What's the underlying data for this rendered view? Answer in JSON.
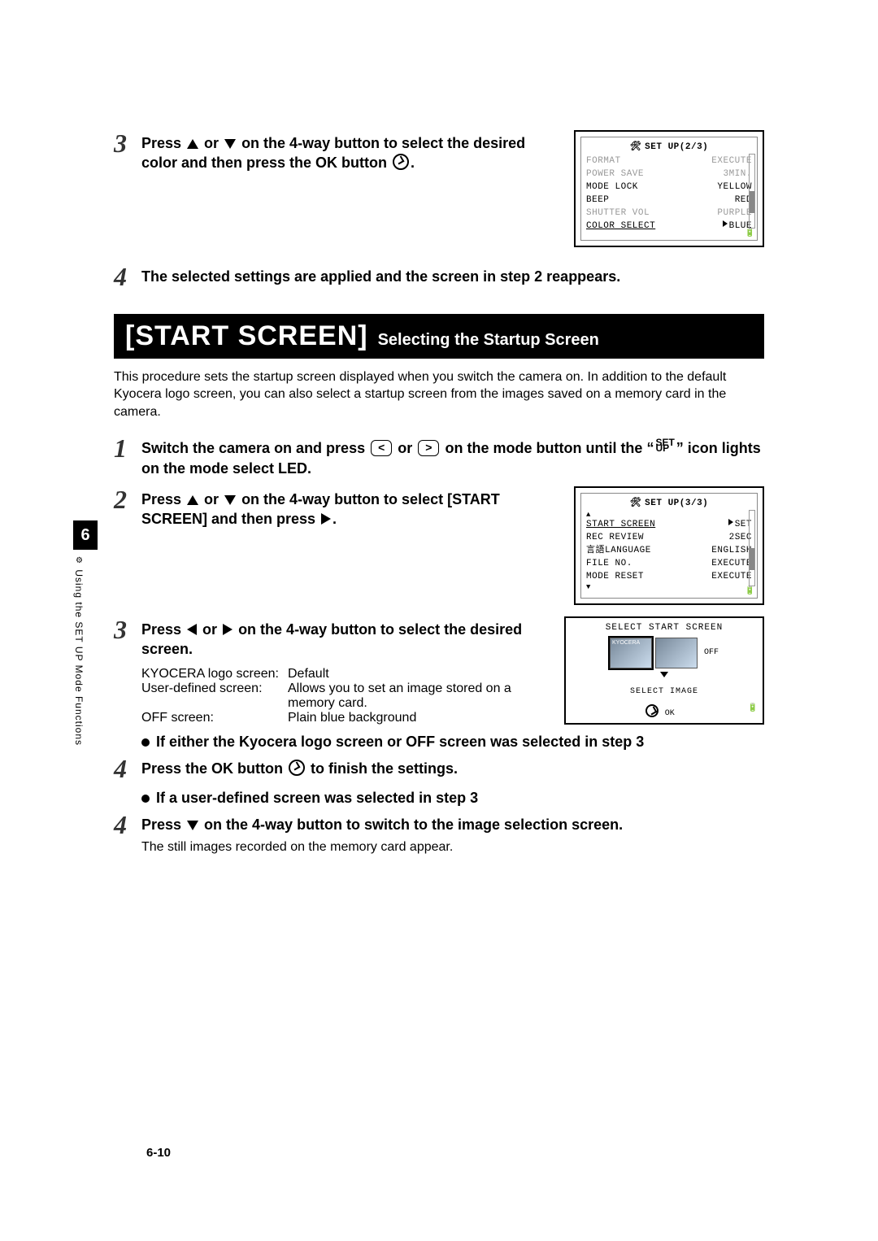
{
  "chapter": "6",
  "side_label": "Using the SET UP Mode Functions",
  "page_num": "6-10",
  "step3a": {
    "text_pre": "Press ",
    "text_mid": " or ",
    "text_post": " on the 4-way button to select the desired color and then press the OK button ",
    "text_end": "."
  },
  "step4a": "The selected settings are applied and the screen in step 2 reappears.",
  "lcd1": {
    "title": "SET UP(2/3)",
    "rows": [
      {
        "l": "FORMAT",
        "r": "EXECUTE",
        "dim": true
      },
      {
        "l": "POWER SAVE",
        "r": "3MIN.",
        "dim": true
      },
      {
        "l": "MODE LOCK",
        "r": "YELLOW",
        "dim": false
      },
      {
        "l": "BEEP",
        "r": "RED",
        "dim": false
      },
      {
        "l": "SHUTTER VOL",
        "r": "PURPLE",
        "dim": true
      },
      {
        "l": "COLOR SELECT",
        "r": "BLUE",
        "sel": true,
        "arrow": true
      }
    ]
  },
  "heading_big": "[START SCREEN]",
  "heading_small": "Selecting the Startup Screen",
  "intro": "This procedure sets the startup screen displayed when you switch the camera on. In addition to the default Kyocera logo screen, you can also select a startup screen from the images saved on a memory card in the camera.",
  "step1b_pre": "Switch the camera on and press ",
  "step1b_mid": " or ",
  "step1b_post": " on the mode button until the “",
  "step1b_icon": "SET\nUP",
  "step1b_end": "” icon lights on the mode select LED.",
  "step2b_pre": "Press ",
  "step2b_mid": " or ",
  "step2b_post": " on the 4-way button to select [START SCREEN] and then press ",
  "step2b_end": ".",
  "lcd2": {
    "title": "SET UP(3/3)",
    "rows": [
      {
        "l": "START SCREEN",
        "r": "SET",
        "sel": true,
        "arrow": true
      },
      {
        "l": "REC REVIEW",
        "r": "2SEC"
      },
      {
        "l": "言語LANGUAGE",
        "r": "ENGLISH"
      },
      {
        "l": "FILE NO.",
        "r": "EXECUTE"
      },
      {
        "l": "MODE RESET",
        "r": "EXECUTE"
      }
    ]
  },
  "step3b_pre": "Press ",
  "step3b_mid": " or ",
  "step3b_post": " on the 4-way button to select the desired screen.",
  "desc": [
    {
      "l": "KYOCERA logo screen:",
      "v": "Default"
    },
    {
      "l": "User-defined screen:",
      "v": "Allows you to set an image stored on a memory card."
    },
    {
      "l": "OFF screen:",
      "v": "Plain blue background"
    }
  ],
  "sel_fig": {
    "title": "SELECT START SCREEN",
    "off": "OFF",
    "sub": "SELECT IMAGE",
    "ok": "OK"
  },
  "bullet1": "If either the Kyocera logo screen or OFF screen was selected in step 3",
  "step4b_pre": "Press the OK button ",
  "step4b_post": " to finish the settings.",
  "bullet2": "If a user-defined screen was selected in step 3",
  "step4c_pre": "Press ",
  "step4c_post": " on the 4-way button to switch to the image selection screen.",
  "step4c_sub": "The still images recorded on the memory card appear."
}
